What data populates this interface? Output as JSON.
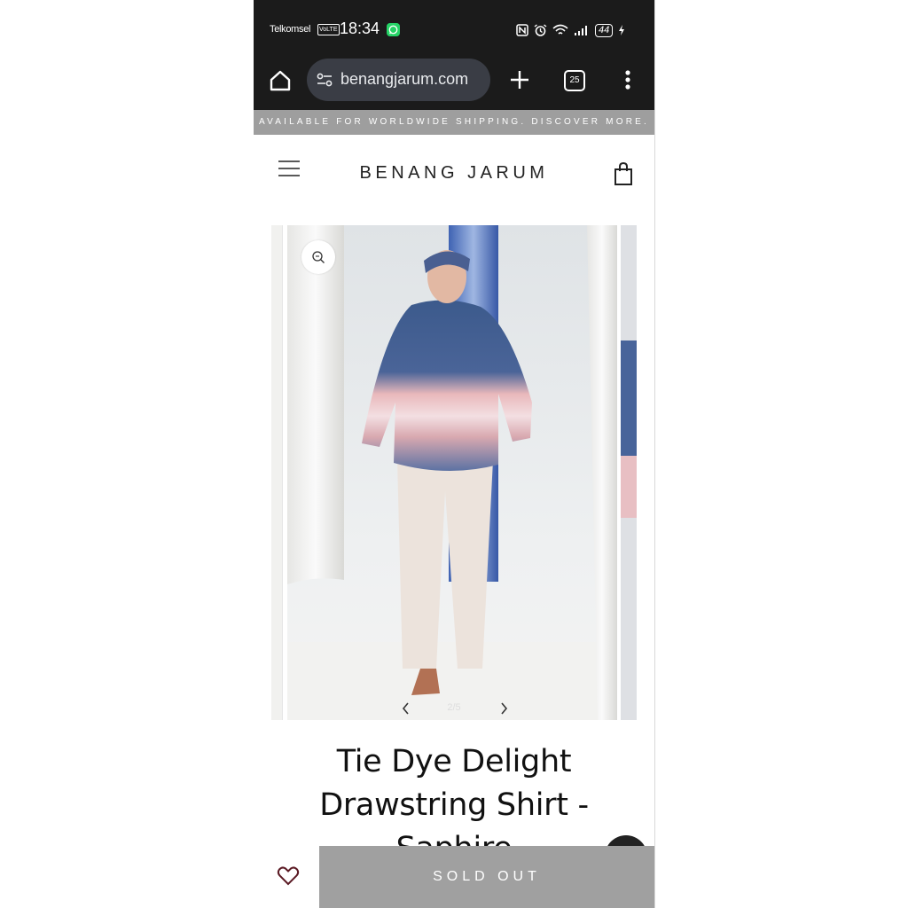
{
  "status_bar": {
    "carrier": "Telkomsel",
    "network_badge": "VoLTE",
    "time": "18:34",
    "battery": "44"
  },
  "browser": {
    "url": "benangjarum.com",
    "tab_count": "25"
  },
  "announcement": "AVAILABLE FOR WORLDWIDE SHIPPING. DISCOVER MORE.",
  "header": {
    "brand": "BENANG JARUM"
  },
  "gallery": {
    "counter": "2/5"
  },
  "product": {
    "title": "Tie Dye Delight Drawstring Shirt - Saphire"
  },
  "actions": {
    "sold_out_label": "SOLD OUT"
  },
  "colors": {
    "status_bar": "#1b1b1b",
    "announcement_bg": "#9e9e9e",
    "sold_out_bg": "#a0a0a0",
    "wishlist_icon": "#5b1a24"
  },
  "icons": {
    "home": "home-icon",
    "site_settings": "tune-icon",
    "new_tab": "plus-icon",
    "menu": "more-vert-icon",
    "hamburger": "hamburger-menu-icon",
    "cart": "shopping-bag-icon",
    "zoom": "zoom-in-icon",
    "wishlist": "heart-icon"
  }
}
